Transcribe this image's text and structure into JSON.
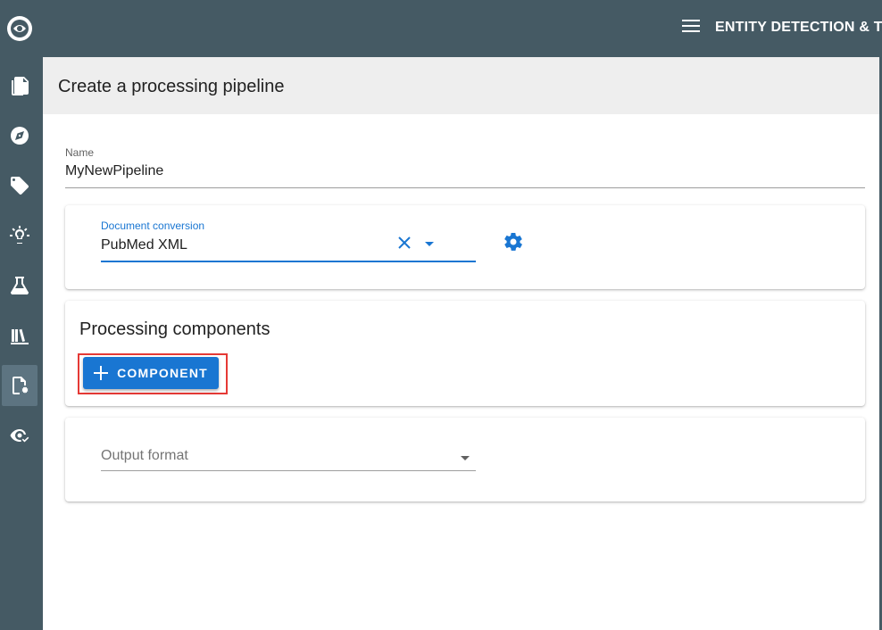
{
  "app": {
    "title": "ENTITY DETECTION & TOKENIZATION"
  },
  "sidebar": {
    "items": [
      {
        "icon": "document-icon"
      },
      {
        "icon": "compass-icon"
      },
      {
        "icon": "tag-icon"
      },
      {
        "icon": "lightbulb-icon"
      },
      {
        "icon": "flask-icon"
      },
      {
        "icon": "library-icon"
      },
      {
        "icon": "file-settings-icon",
        "active": true
      },
      {
        "icon": "eye-check-icon"
      }
    ]
  },
  "page": {
    "title": "Create a processing pipeline"
  },
  "form": {
    "name_label": "Name",
    "name_value": "MyNewPipeline",
    "document_conversion": {
      "label": "Document conversion",
      "value": "PubMed XML"
    },
    "processing_components": {
      "title": "Processing components",
      "add_button_label": "COMPONENT"
    },
    "output_format": {
      "placeholder": "Output format"
    }
  },
  "colors": {
    "sidebar": "#455a64",
    "accent": "#1976d2",
    "header_bg": "#eeeeee",
    "highlight": "#e53935"
  }
}
